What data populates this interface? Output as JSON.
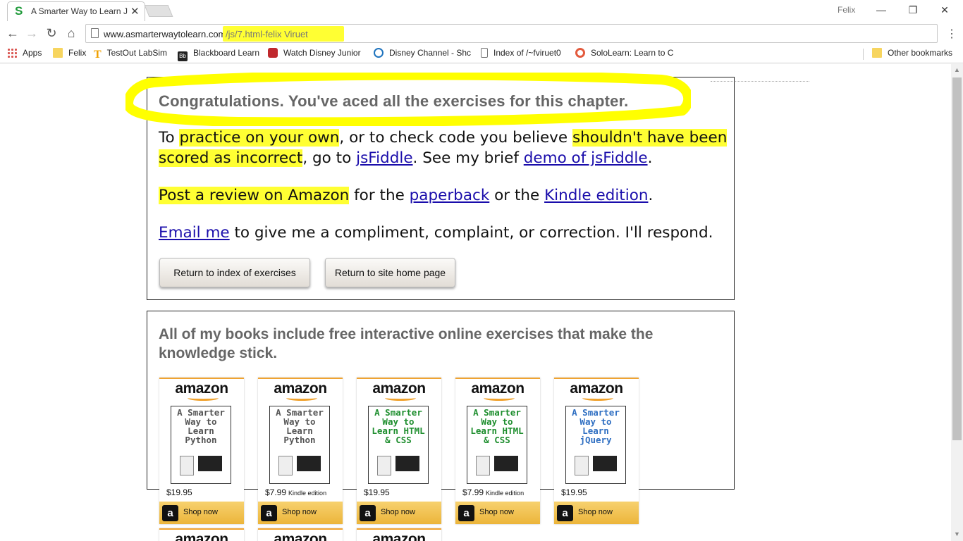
{
  "browser": {
    "tab_title": "A Smarter Way to Learn J",
    "tab_favicon": "S",
    "user_name": "Felix",
    "url_host": "www.asmarterwaytolearn.com",
    "url_path": "/js/7.html-felix Viruet",
    "bookmarks": [
      {
        "label": "Apps",
        "icon": "apps-grid-icon"
      },
      {
        "label": "Felix",
        "icon": "folder-icon"
      },
      {
        "label": "TestOut LabSim",
        "icon": "testout-icon"
      },
      {
        "label": "Blackboard Learn",
        "icon": "blackboard-icon"
      },
      {
        "label": "Watch Disney Junior",
        "icon": "disney-junior-icon"
      },
      {
        "label": "Disney Channel - Shc",
        "icon": "disney-channel-icon"
      },
      {
        "label": "Index of /~fviruet0",
        "icon": "page-icon"
      },
      {
        "label": "SoloLearn: Learn to C",
        "icon": "sololearn-icon"
      }
    ],
    "other_bookmarks": "Other bookmarks",
    "colors": {
      "highlight": "#ffff33",
      "link": "#1a0dab"
    }
  },
  "page": {
    "congrats": "Congratulations. You've aced all the exercises for this chapter.",
    "practice": {
      "p1": "To ",
      "p2": "practice on your own",
      "p3": ", or to check code you believe ",
      "p4": "shouldn't have been",
      "p5": "scored as incorrect",
      "p6": ", go to ",
      "link1": "jsFiddle",
      "p7": ". See my brief ",
      "link2": "demo of jsFiddle",
      "p8": "."
    },
    "review": {
      "hl": "Post a review on Amazon",
      "t1": " for the ",
      "link1": "paperback",
      "t2": " or the ",
      "link2": "Kindle edition",
      "t3": "."
    },
    "email": {
      "link": "Email me",
      "text": " to give me a compliment, complaint, or correction. I'll respond."
    },
    "buttons": {
      "index": "Return to index of exercises",
      "home": "Return to site home page"
    },
    "books_heading": " All of my books include free interactive online exercises that make the knowledge stick.",
    "amazon_logo": "amazon",
    "shop_now": "Shop now",
    "books": [
      {
        "title": "A Smarter Way to Learn Python",
        "price": "$19.95",
        "edition": "",
        "title_color": "#555555"
      },
      {
        "title": "A Smarter Way to Learn Python",
        "price": "$7.99",
        "edition": "Kindle edition",
        "title_color": "#555555"
      },
      {
        "title": "A Smarter Way to Learn HTML & CSS",
        "price": "$19.95",
        "edition": "",
        "title_color": "#1e8e2e"
      },
      {
        "title": "A Smarter Way to Learn HTML & CSS",
        "price": "$7.99",
        "edition": "Kindle edition",
        "title_color": "#1e8e2e"
      },
      {
        "title": "A Smarter Way to Learn jQuery",
        "price": "$19.95",
        "edition": "",
        "title_color": "#2f6fc2"
      }
    ]
  }
}
